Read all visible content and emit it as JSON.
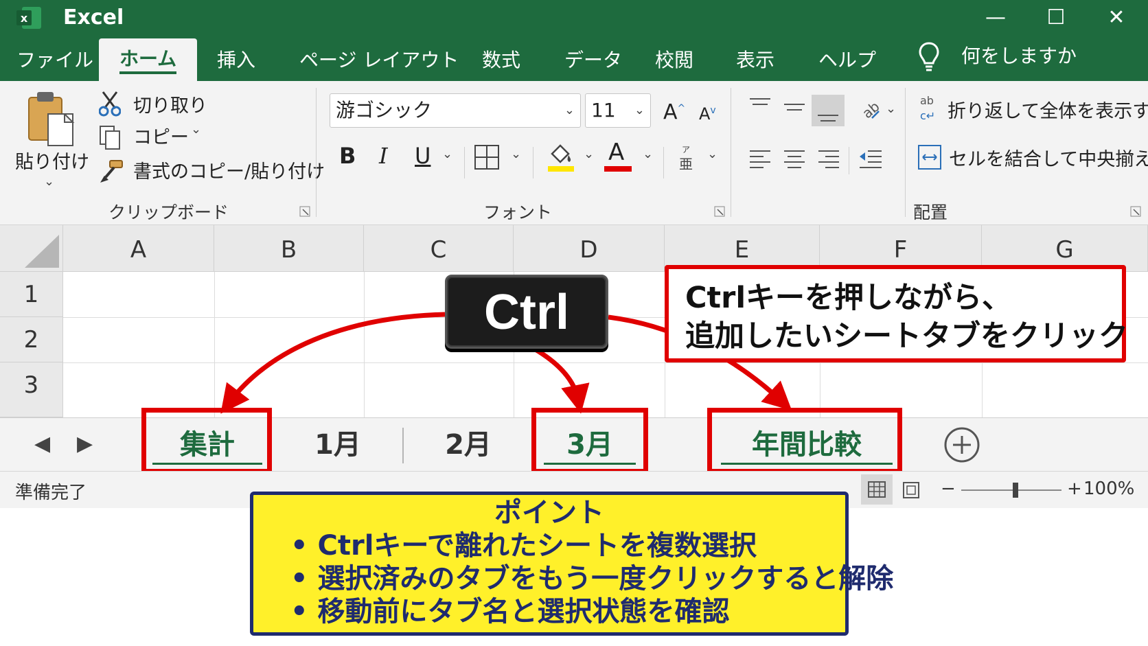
{
  "app": {
    "title": "Excel",
    "logo_letter": "x"
  },
  "window": {
    "minimize": "—",
    "maximize": "☐",
    "close": "✕"
  },
  "ribbon_tabs": [
    "ファイル",
    "ホーム",
    "挿入",
    "ページ レイアウト",
    "数式",
    "データ",
    "校閲",
    "表示",
    "ヘルプ"
  ],
  "tell_me": "何をしますか",
  "clipboard": {
    "paste": "貼り付け",
    "cut": "切り取り",
    "copy": "コピー",
    "format_painter": "書式のコピー/貼り付け",
    "group": "クリップボード"
  },
  "font": {
    "name": "游ゴシック",
    "size": "11",
    "grow": "A",
    "shrink": "A",
    "bold": "B",
    "italic": "I",
    "underline": "U",
    "color_letter": "A",
    "group": "フォント"
  },
  "alignment": {
    "wrap": "折り返して全体を表示する",
    "merge": "セルを結合して中央揃え",
    "group": "配置"
  },
  "grid": {
    "columns": [
      "A",
      "B",
      "C",
      "D",
      "E",
      "F",
      "G"
    ],
    "rows": [
      "1",
      "2",
      "3"
    ]
  },
  "sheet_tabs": [
    {
      "name": "集計",
      "selected": true
    },
    {
      "name": "1月",
      "selected": false
    },
    {
      "name": "2月",
      "selected": false
    },
    {
      "name": "3月",
      "selected": true
    },
    {
      "name": "年間比較",
      "selected": true
    }
  ],
  "status": {
    "ready": "準備完了",
    "zoom": "100%",
    "zoom_level": 1.0
  },
  "callout": {
    "key": "Ctrl",
    "line1": "Ctrlキーを押しながら、",
    "line2": "追加したいシートタブをクリック"
  },
  "point": {
    "title": "ポイント",
    "items": [
      "Ctrlキーで離れたシートを複数選択",
      "選択済みのタブをもう一度クリックすると解除",
      "移動前にタブ名と選択状態を確認"
    ]
  },
  "colors": {
    "excel_green": "#1e6b3e",
    "highlight_red": "#e00000",
    "note_yellow": "#fff02a",
    "note_navy": "#1f2b6e"
  }
}
